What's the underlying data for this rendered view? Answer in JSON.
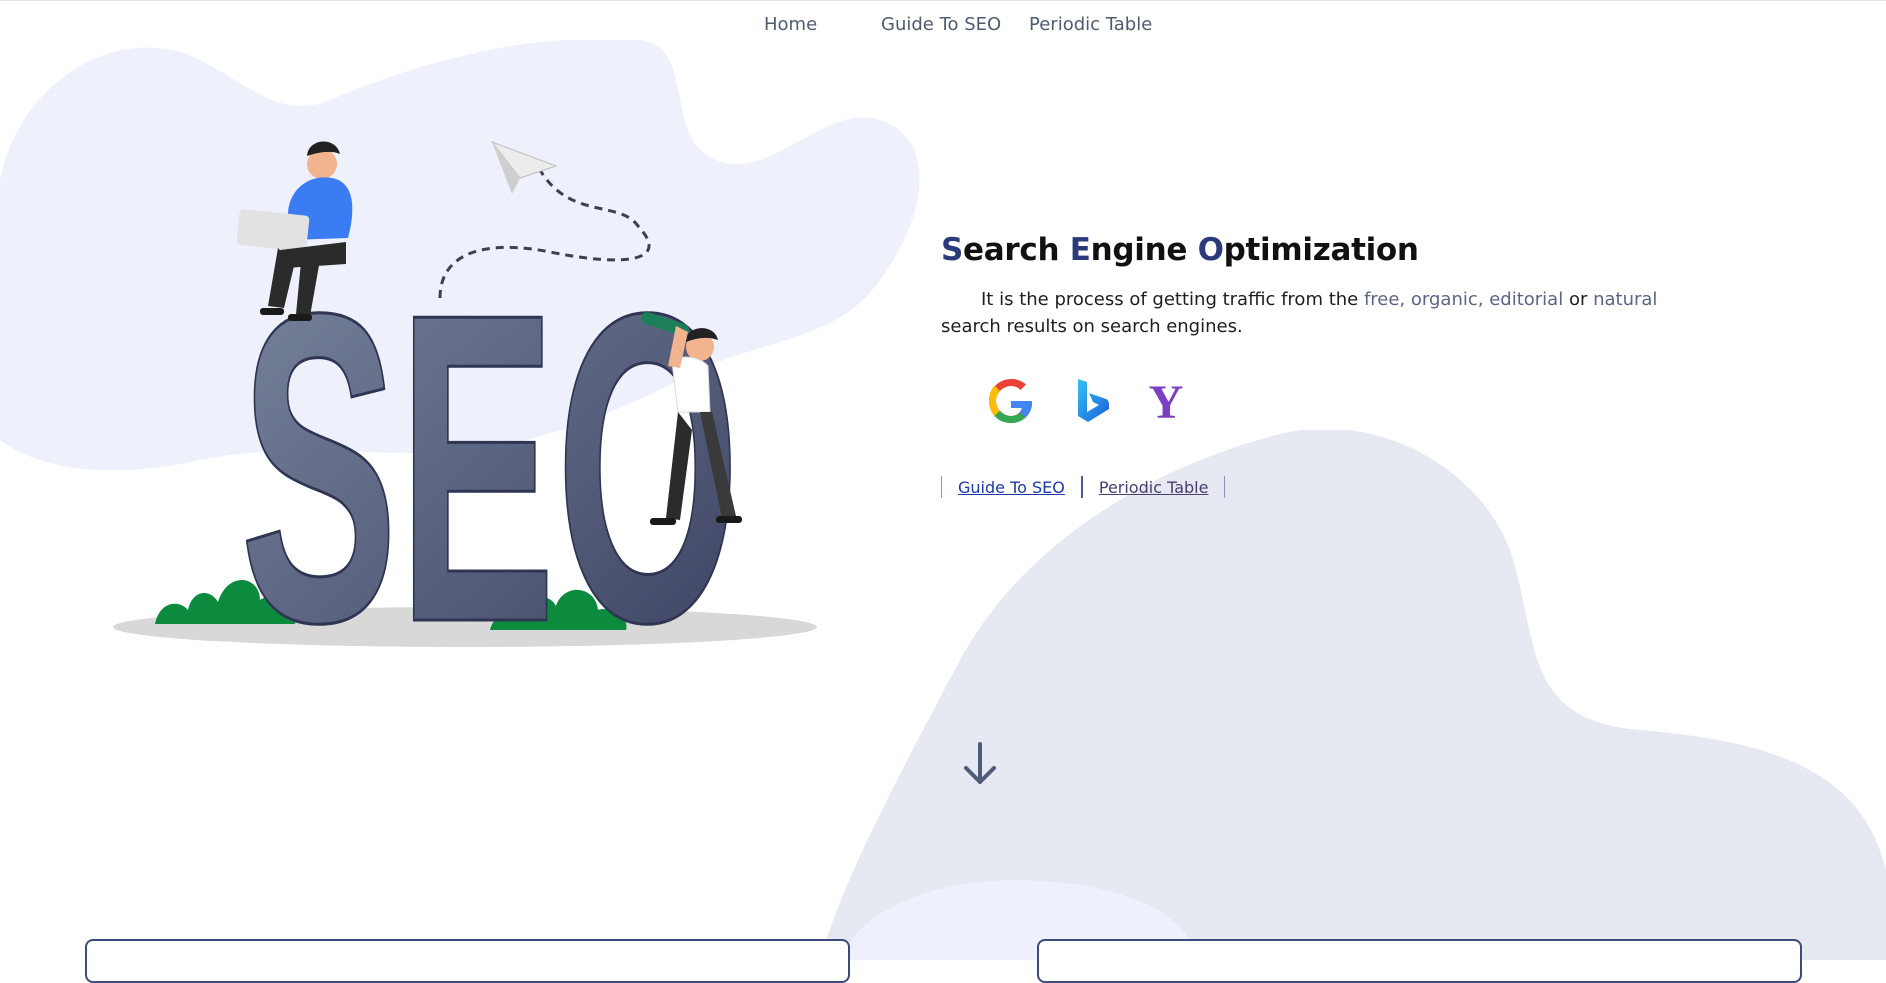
{
  "nav": {
    "home": "Home",
    "guide": "Guide To SEO",
    "periodic": "Periodic Table"
  },
  "hero": {
    "illustration_letters": "SEO",
    "title": {
      "w1_cap": "S",
      "w1_rest": "earch ",
      "w2_cap": "E",
      "w2_rest": "ngine ",
      "w3_cap": "O",
      "w3_rest": "ptimization"
    },
    "desc": {
      "part1": "It is the process of getting traffic from the ",
      "highlight1": "free, organic, editorial",
      "part2": " or ",
      "highlight2": "natural",
      "part3": " search results on search engines."
    }
  },
  "engines": [
    {
      "name": "google",
      "icon": "google-icon"
    },
    {
      "name": "bing",
      "icon": "bing-icon"
    },
    {
      "name": "yahoo",
      "icon": "yahoo-icon",
      "glyph": "Y"
    }
  ],
  "links": {
    "guide": "Guide To SEO",
    "periodic": "Periodic Table"
  },
  "colors": {
    "accent": "#2b3a7a",
    "blob_left": "#eef1fb",
    "blob_right": "#e6e9f1",
    "link": "#1d38a9",
    "link_visited": "#4b3c70"
  }
}
